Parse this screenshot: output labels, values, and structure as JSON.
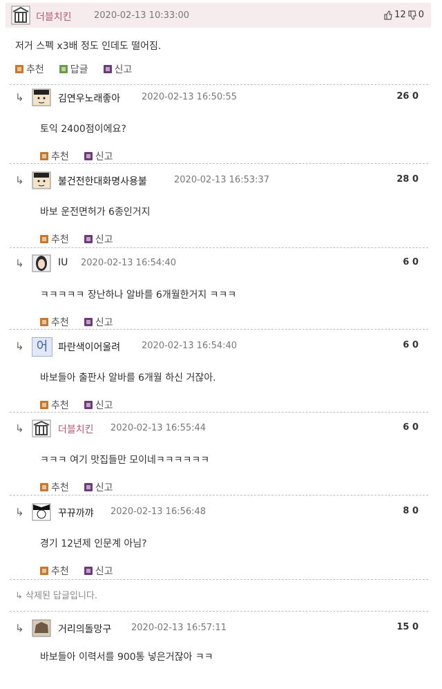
{
  "post": {
    "nick": "더블치킨",
    "time": "2020-02-13 10:33:00",
    "up": "12",
    "down": "0",
    "body": "저거 스펙 x3배 정도 인데도 떨어짐.",
    "actions": {
      "recommend": "추천",
      "reply": "답글",
      "report": "신고"
    }
  },
  "comments": [
    {
      "nick": "김연우노래좋아",
      "time": "2020-02-13 16:50:55",
      "score": "26 0",
      "text": "토익 2400점이에요?",
      "recommend": "추천",
      "report": "신고"
    },
    {
      "nick": "불건전한대화명사용불",
      "time": "2020-02-13 16:53:37",
      "score": "28 0",
      "text": "바보 운전면허가 6종인거지",
      "recommend": "추천",
      "report": "신고"
    },
    {
      "nick": "IU",
      "time": "2020-02-13 16:54:40",
      "score": "6 0",
      "text": "ㅋㅋㅋㅋㅋ 장난하나 알바를 6개월한거지 ㅋㅋㅋ",
      "recommend": "추천",
      "report": "신고"
    },
    {
      "nick": "파란색이어울려",
      "time": "2020-02-13 16:54:40",
      "score": "6 0",
      "text": "바보들아 출판사 알바를 6개월 하신 거잖아.",
      "recommend": "추천",
      "report": "신고",
      "avatar_char": "어"
    },
    {
      "nick": "더블치킨",
      "time": "2020-02-13 16:55:44",
      "score": "6 0",
      "text": "ㅋㅋㅋ 여기 맛집들만 모이네ㅋㅋㅋㅋㅋㅋ",
      "recommend": "추천",
      "report": "신고"
    },
    {
      "nick": "꾸뀨까꺄",
      "time": "2020-02-13 16:56:48",
      "score": "8 0",
      "text": "경기 12년제 인문계 아님?",
      "recommend": "추천",
      "report": "신고"
    }
  ],
  "deleted_text": "삭제된 답글입니다.",
  "last_comment": {
    "nick": "거리의돌망구",
    "time": "2020-02-13 16:57:11",
    "score": "15 0",
    "text": "바보들아 이력서를 900통 넣은거잖아 ㅋㅋ"
  },
  "reply_arrow": "↳",
  "colors": {
    "op_header_bg": "#f6ecee",
    "op_nick": "#b55a73",
    "recommend_icon": "#c8782c",
    "reply_icon": "#6b9a46",
    "report_icon": "#6e3b7a"
  }
}
